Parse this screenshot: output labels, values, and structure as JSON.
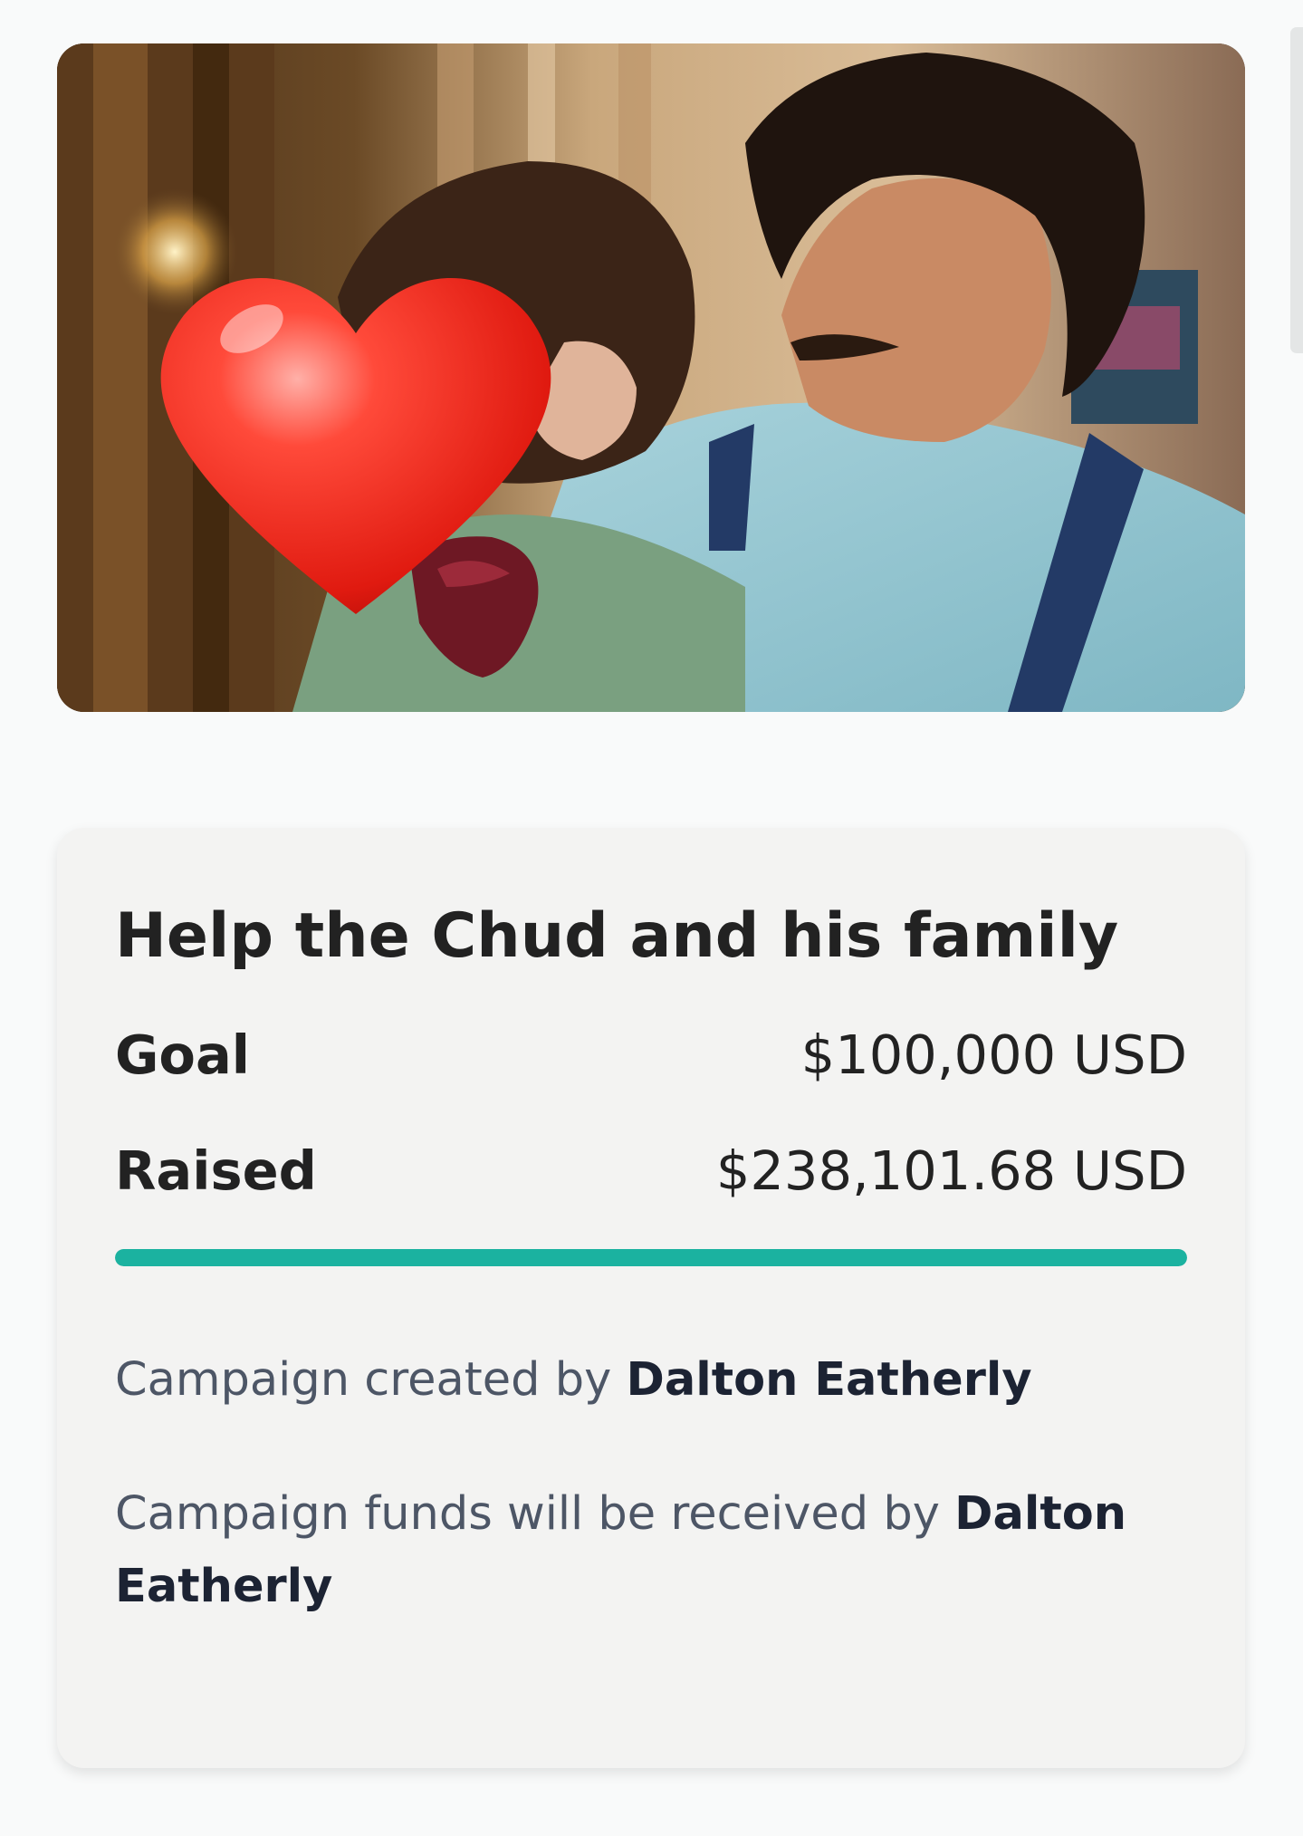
{
  "campaign": {
    "title": "Help the Chud and his family",
    "goal_label": "Goal",
    "goal_value": "$100,000 USD",
    "raised_label": "Raised",
    "raised_value": "$238,101.68 USD",
    "progress_fraction": 1.0,
    "progress_color": "#1bb2a0",
    "created_by_prefix": "Campaign created by",
    "created_by_name": "Dalton Eatherly",
    "received_by_prefix": "Campaign funds will be received by",
    "received_by_name": "Dalton Eatherly"
  },
  "hero_image": {
    "overlay_icon": "heart-emoji-icon"
  }
}
